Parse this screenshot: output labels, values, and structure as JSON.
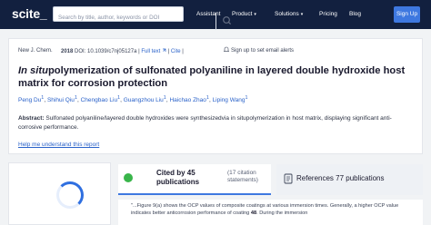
{
  "nav": {
    "logo": "scite_",
    "search_placeholder": "Search by title, author, keywords or DOI",
    "items": [
      "Assistant",
      "Product",
      "Solutions",
      "Pricing",
      "Blog"
    ],
    "signin": "Sign Up"
  },
  "paper": {
    "journal": "New J. Chem.",
    "year": "2018",
    "doi": "DOI: 10.1039/c7nj05127a",
    "full_text": "Full text",
    "cite": "Cite",
    "alert": "Sign up to set email alerts",
    "title_italic": "In situ",
    "title_rest": "polymerization of sulfonated polyaniline in layered double hydroxide host matrix for corrosion protection",
    "authors": [
      "Peng Du",
      "Shihui Qiu",
      "Chengbao Liu",
      "Guangzhou Liu",
      "Haichao Zhao",
      "Liping Wang"
    ],
    "abstract_label": "Abstract:",
    "abstract_text": "Sulfonated polyaniline/layered double hydroxides were synthesizedvia in situpolymerization in host matrix, displaying significant anti-corrosive performance.",
    "help_link": "Help me understand this report"
  },
  "citations": {
    "cited_label": "Cited by 45 publications",
    "cited_sub": "(17 citation statements)",
    "refs_label": "References 77 publications",
    "snippet_pre": "\"...Figure 9(a) shows the OCP values of composite coatings at various immersion times. Generally, a higher OCP value indicates better anticorrosion performance of coating",
    "snippet_ref": "48",
    "snippet_post": ". During the immersion"
  },
  "colors": {
    "nav_bg": "#12203f",
    "accent": "#3e78e0",
    "link": "#2a62c9",
    "cited_icon": "#39b54a"
  }
}
